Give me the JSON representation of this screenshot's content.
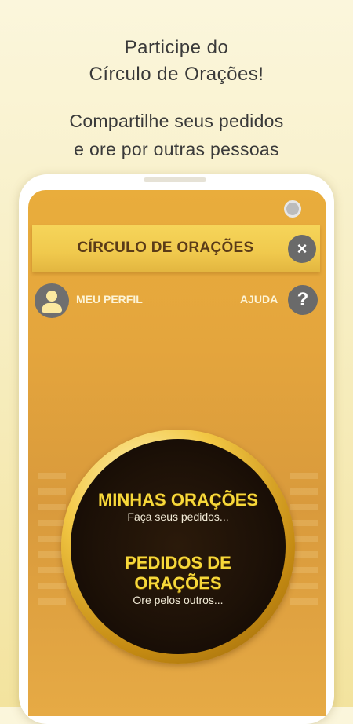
{
  "promo": {
    "line1": "Participe do",
    "line2": "Círculo de Orações!",
    "line3": "Compartilhe seus pedidos",
    "line4": "e ore por outras pessoas"
  },
  "app": {
    "header_title": "CÍRCULO DE ORAÇÕES",
    "close_icon": "×",
    "profile_label": "MEU PERFIL",
    "help_label": "AJUDA",
    "help_icon": "?"
  },
  "menu": {
    "my_prayers_title": "MINHAS ORAÇÕES",
    "my_prayers_subtitle": "Faça seus pedidos...",
    "requests_title_line1": "PEDIDOS DE",
    "requests_title_line2": "ORAÇÕES",
    "requests_subtitle": "Ore pelos outros..."
  },
  "colors": {
    "background": "#f7eec2",
    "screen": "#e4a53d",
    "header_bar": "#f0c94d",
    "title_gold": "#f7d83a",
    "disc_dark": "#1d1107",
    "icon_gray": "#6a6a6a"
  },
  "icons": [
    "settings-dot-icon",
    "close-icon",
    "user-avatar-icon",
    "help-icon"
  ]
}
